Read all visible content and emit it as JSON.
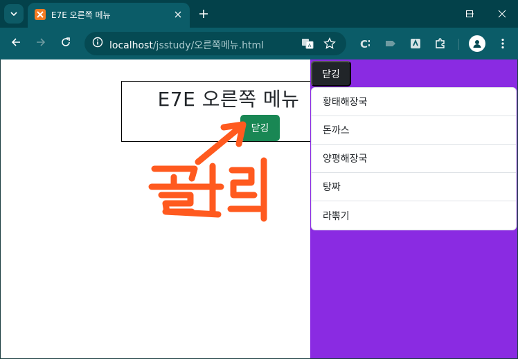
{
  "browser": {
    "tab_title": "E7E 오른쪽 메뉴",
    "url_host": "localhost",
    "url_path": "/jsstudy/오른쪽메뉴.html"
  },
  "page": {
    "title": "E7E 오른쪽 메뉴",
    "toggle_button_label": "닫깅",
    "annotation_text": "클릭",
    "annotation_color": "#ff5a1f"
  },
  "side_panel": {
    "background": "#8a2be2",
    "close_button_label": "닫깅",
    "menu_items": [
      {
        "label": "황태해장국"
      },
      {
        "label": "돈까스"
      },
      {
        "label": "양평해장국"
      },
      {
        "label": "탕짜"
      },
      {
        "label": "라뽂기"
      }
    ]
  }
}
